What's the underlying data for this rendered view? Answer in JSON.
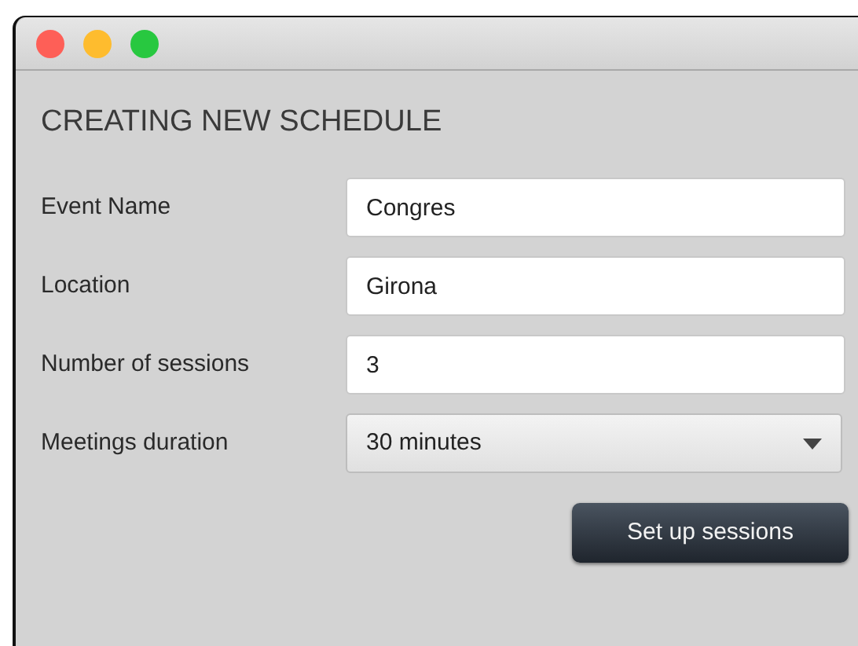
{
  "window": {
    "controls": [
      {
        "color": "#fe5f57"
      },
      {
        "color": "#febc2e"
      },
      {
        "color": "#28c840"
      }
    ]
  },
  "heading": "CREATING NEW SCHEDULE",
  "fields": [
    {
      "kind": "text",
      "label": "Event Name",
      "value": "Congres"
    },
    {
      "kind": "text",
      "label": "Location",
      "value": "Girona"
    },
    {
      "kind": "text",
      "label": "Number of sessions",
      "value": "3"
    },
    {
      "kind": "select",
      "label": "Meetings duration",
      "value": "30 minutes"
    }
  ],
  "button": "Set up sessions"
}
